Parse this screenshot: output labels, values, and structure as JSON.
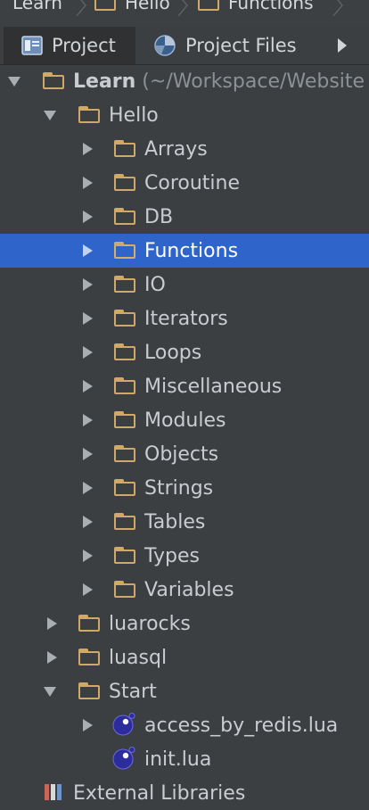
{
  "breadcrumb": [
    "Learn",
    "Hello",
    "Functions"
  ],
  "tabs": {
    "project": "Project",
    "project_files": "Project Files"
  },
  "tree": {
    "root": {
      "label": "Learn",
      "suffix": "(~/Workspace/Website"
    },
    "hello": "Hello",
    "hello_children": [
      "Arrays",
      "Coroutine",
      "DB",
      "Functions",
      "IO",
      "Iterators",
      "Loops",
      "Miscellaneous",
      "Modules",
      "Objects",
      "Strings",
      "Tables",
      "Types",
      "Variables"
    ],
    "selected": "Functions",
    "luarocks": "luarocks",
    "luasql": "luasql",
    "start": "Start",
    "start_children": [
      "access_by_redis.lua",
      "init.lua"
    ],
    "bottom_partial": "External Libraries"
  },
  "colors": {
    "background": "#3c3f41",
    "selection": "#2f65ca",
    "folder": "#d0a969",
    "lua_file": "#2c2c9e"
  },
  "icons": {
    "folder": "folder-icon",
    "lua": "lua-file-icon",
    "expand": "expand-arrow-icon",
    "collapse": "collapse-arrow-icon",
    "project": "project-view-icon",
    "project_files": "project-files-icon",
    "more": "chevron-right-icon"
  }
}
